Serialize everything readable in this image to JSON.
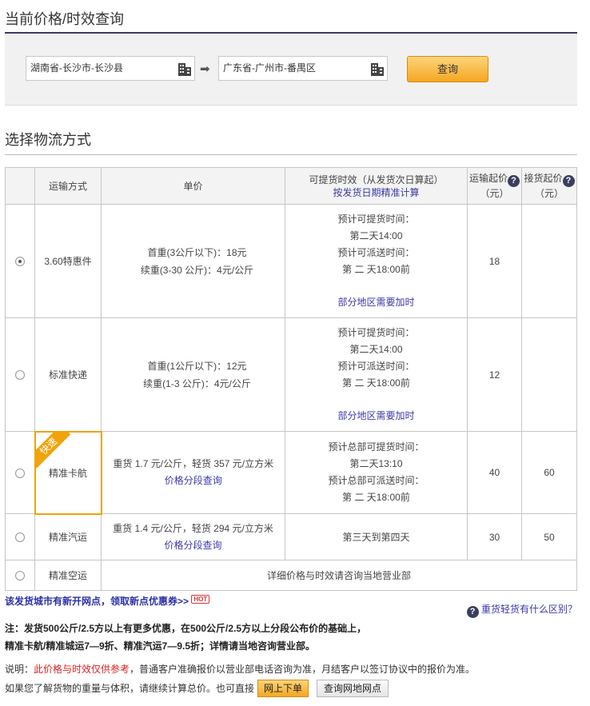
{
  "header": {
    "title": "当前价格/时效查询"
  },
  "query": {
    "from": "湖南省-长沙市-长沙县",
    "to": "广东省-广州市-番禺区",
    "arrow": "➡",
    "button": "查询"
  },
  "section2": {
    "title": "选择物流方式"
  },
  "table": {
    "headers": {
      "method": "运输方式",
      "unit_price": "单价",
      "timing": "可提货时效（从发货次日算起）",
      "timing_link": "按发货日期精准计算",
      "start_price": "运输起价",
      "start_unit": "（元）",
      "pickup_price": "接货起价",
      "pickup_unit": "（元）",
      "q": "?"
    },
    "rows": [
      {
        "name": "3.60特惠件",
        "price1": "首重(3公斤以下)：18元",
        "price2": "续重(3-30 公斤)：4元/公斤",
        "t1": "预计可提货时间：",
        "t2": "第二天14:00",
        "t3": "预计可派送时间：",
        "t4": "第 二 天18:00前",
        "t5": "部分地区需要加时",
        "start": "18",
        "pickup": ""
      },
      {
        "name": "标准快递",
        "price1": "首重(1公斤以下)：12元",
        "price2": "续重(1-3 公斤)：4元/公斤",
        "t1": "预计可提货时间：",
        "t2": "第二天14:00",
        "t3": "预计可派送时间：",
        "t4": "第 二 天18:00前",
        "t5": "部分地区需要加时",
        "start": "12",
        "pickup": ""
      },
      {
        "name": "精准卡航",
        "badge": "快速",
        "price1": "重货 1.7 元/公斤，轻货 357 元/立方米",
        "price_link": "价格分段查询",
        "t1": "预计总部可提货时间：",
        "t2": "第二天13:10",
        "t3": "预计总部可派送时间：",
        "t4": "第 二 天18:00前",
        "start": "40",
        "pickup": "60"
      },
      {
        "name": "精准汽运",
        "price1": "重货 1.4 元/公斤，轻货 294 元/立方米",
        "price_link": "价格分段查询",
        "t1": "第三天到第四天",
        "start": "30",
        "pickup": "50"
      },
      {
        "name": "精准空运",
        "merged": "详细价格与时效请咨询当地营业部"
      }
    ]
  },
  "footer": {
    "promo": "该发货城市有新开网点，领取新点优惠券>>",
    "hot": "HOT",
    "diff_link": "重货轻货有什么区别？",
    "note1": "注：发货500公斤/2.5方以上有更多优惠，在500公斤/2.5方以上分段公布价的基础上，",
    "note2": "精准卡航/精准城运7—9折、精准汽运7—9.5折；详情请当地咨询营业部。",
    "disc_prefix": "说明：",
    "disc_red": "此价格与时效仅供参考",
    "disc_rest": "，普通客户准确报价以营业部电话咨询为准，月结客户以签订协议中的报价为准。",
    "bottom_text": "如果您了解货物的重量与体积，请继续计算总价。也可直接",
    "order_btn": "网上下单",
    "net_btn": "查询网地网点"
  },
  "colors": {
    "accent": "#3c3a68",
    "button": "#f5a623",
    "link": "#3a39a8",
    "warning": "#e02020",
    "badge": "#f0a30a"
  }
}
